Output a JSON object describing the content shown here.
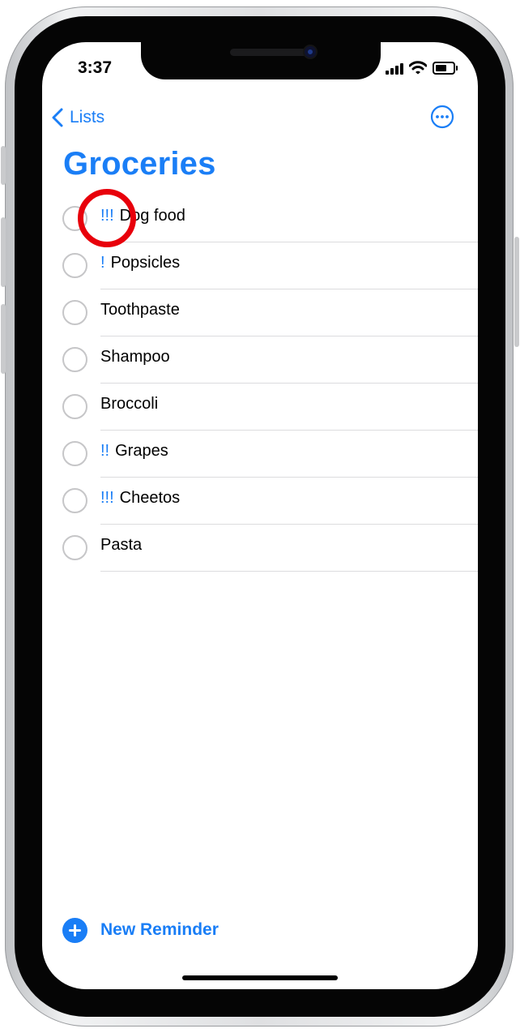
{
  "status_bar": {
    "time": "3:37"
  },
  "nav": {
    "back_label": "Lists"
  },
  "list": {
    "title": "Groceries",
    "items": [
      {
        "priority": "!!!",
        "name": "Dog food"
      },
      {
        "priority": "!",
        "name": "Popsicles"
      },
      {
        "priority": "",
        "name": "Toothpaste"
      },
      {
        "priority": "",
        "name": "Shampoo"
      },
      {
        "priority": "",
        "name": "Broccoli"
      },
      {
        "priority": "!!",
        "name": "Grapes"
      },
      {
        "priority": "!!!",
        "name": "Cheetos"
      },
      {
        "priority": "",
        "name": "Pasta"
      }
    ]
  },
  "footer": {
    "new_reminder_label": "New Reminder"
  },
  "colors": {
    "accent": "#1a7ef6",
    "annotation": "#e8000b"
  },
  "icons": [
    "chevron-left-icon",
    "ellipsis-circle-icon",
    "plus-circle-icon",
    "signal-icon",
    "wifi-icon",
    "battery-icon"
  ]
}
